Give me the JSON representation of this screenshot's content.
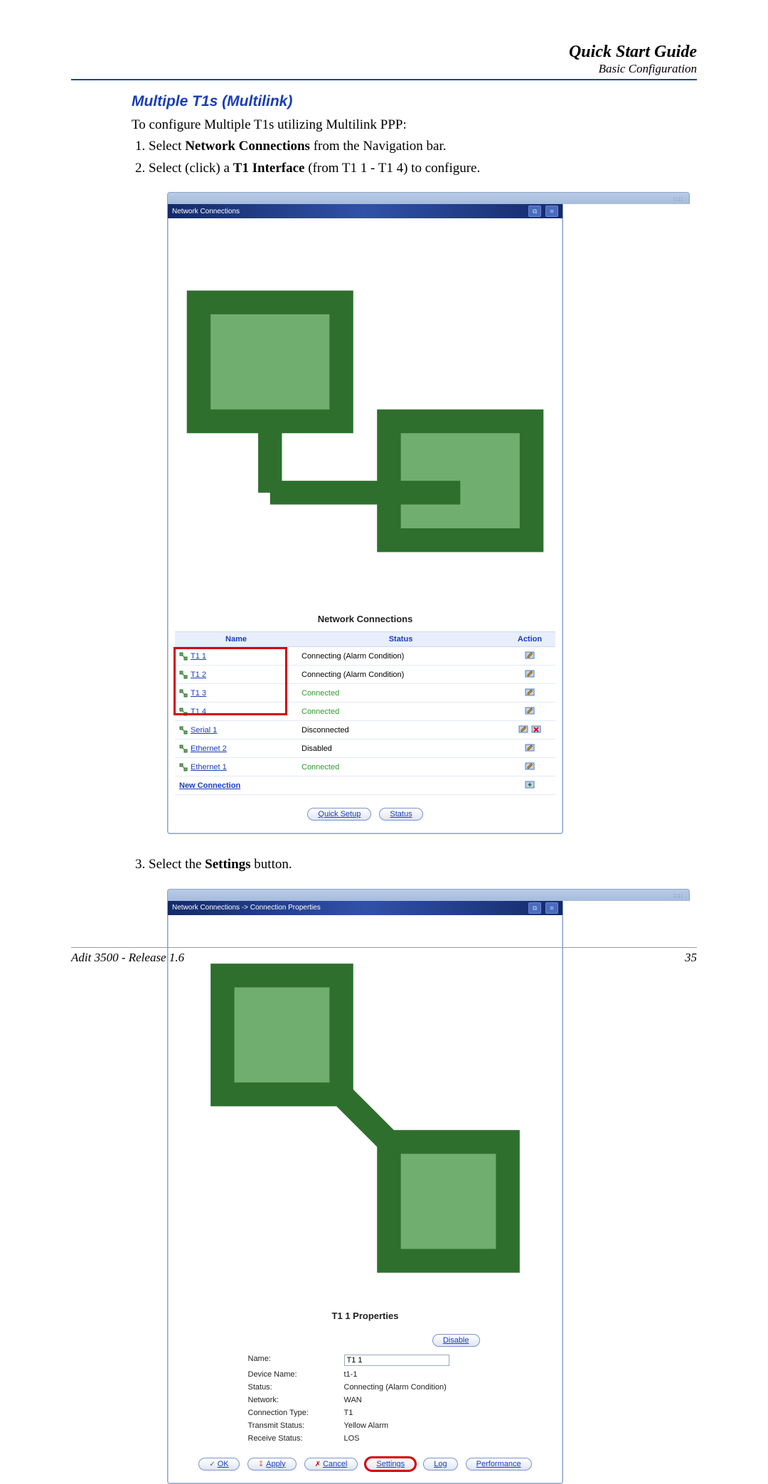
{
  "header": {
    "title": "Quick Start Guide",
    "subtitle": "Basic Configuration"
  },
  "section_title": "Multiple T1s (Multilink)",
  "intro": "To configure Multiple T1s utilizing Multilink PPP:",
  "steps": {
    "s1_pre": "Select ",
    "s1_b": "Network Connections",
    "s1_post": " from the Navigation bar.",
    "s2_pre": "Select (click) a ",
    "s2_b": "T1 Interface",
    "s2_post": " (from T1 1 - T1 4) to configure.",
    "s3_pre": "Select the ",
    "s3_b": "Settings",
    "s3_post": " button."
  },
  "screenshot1": {
    "titlebar": "Network Connections",
    "panel_title": "Network Connections",
    "columns": {
      "name": "Name",
      "status": "Status",
      "action": "Action"
    },
    "rows": [
      {
        "name": "T1 1",
        "status": "Connecting (Alarm Condition)",
        "status_ok": false,
        "icons": [
          "edit"
        ]
      },
      {
        "name": "T1 2",
        "status": "Connecting (Alarm Condition)",
        "status_ok": false,
        "icons": [
          "edit"
        ]
      },
      {
        "name": "T1 3",
        "status": "Connected",
        "status_ok": true,
        "icons": [
          "edit"
        ]
      },
      {
        "name": "T1 4",
        "status": "Connected",
        "status_ok": true,
        "icons": [
          "edit"
        ]
      },
      {
        "name": "Serial 1",
        "status": "Disconnected",
        "status_ok": false,
        "icons": [
          "edit",
          "delete"
        ]
      },
      {
        "name": "Ethernet 2",
        "status": "Disabled",
        "status_ok": false,
        "icons": [
          "edit"
        ]
      },
      {
        "name": "Ethernet 1",
        "status": "Connected",
        "status_ok": true,
        "icons": [
          "edit"
        ]
      }
    ],
    "new_connection": "New Connection",
    "buttons": {
      "quick_setup": "Quick Setup",
      "status": "Status"
    }
  },
  "screenshot2": {
    "breadcrumb": "Network Connections -> Connection Properties",
    "panel_title": "T1 1 Properties",
    "disable_btn": "Disable",
    "fields": [
      {
        "label": "Name:",
        "value": "T1 1",
        "input": true
      },
      {
        "label": "Device Name:",
        "value": "t1-1"
      },
      {
        "label": "Status:",
        "value": "Connecting (Alarm Condition)"
      },
      {
        "label": "Network:",
        "value": "WAN"
      },
      {
        "label": "Connection Type:",
        "value": "T1"
      },
      {
        "label": "Transmit Status:",
        "value": "Yellow Alarm"
      },
      {
        "label": "Receive Status:",
        "value": "LOS"
      }
    ],
    "buttons": {
      "ok": "OK",
      "apply": "Apply",
      "cancel": "Cancel",
      "settings": "Settings",
      "log": "Log",
      "performance": "Performance"
    }
  },
  "footer": {
    "left": "Adit 3500  - Release 1.6",
    "right": "35"
  }
}
